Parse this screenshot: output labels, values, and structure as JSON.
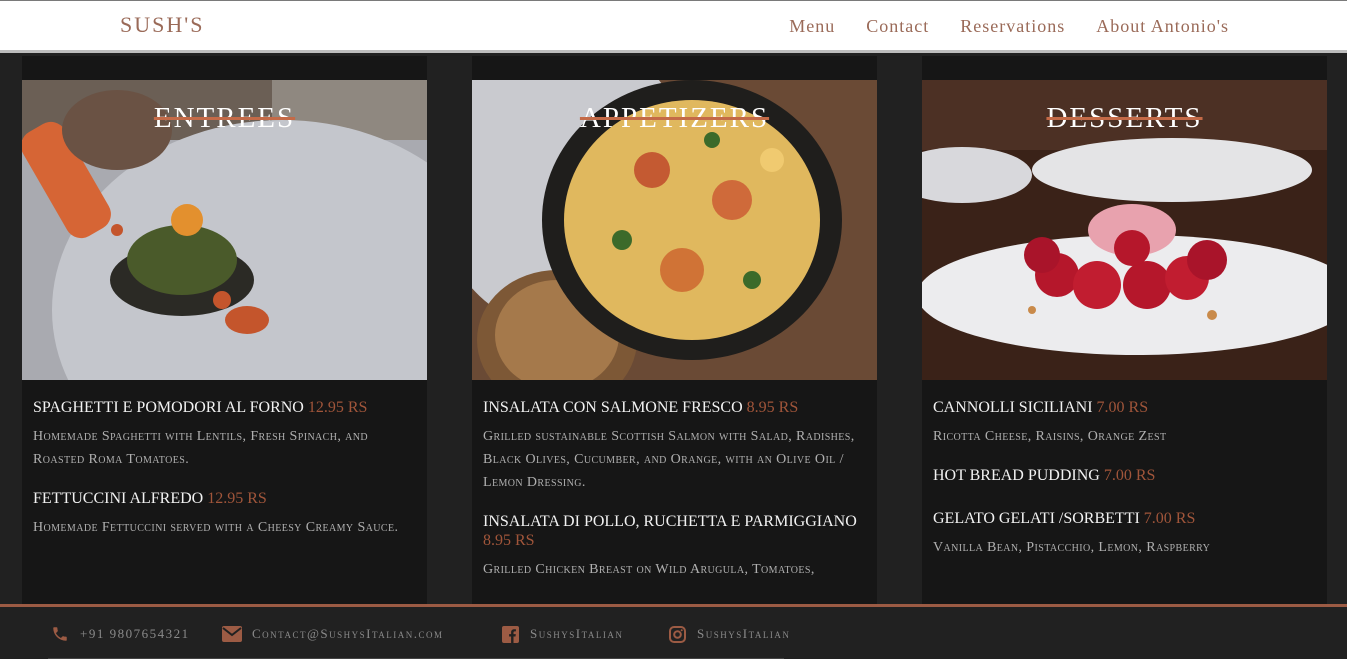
{
  "header": {
    "brand": "SUSH'S",
    "nav": [
      "Menu",
      "Contact",
      "Reservations",
      "About Antonio's"
    ]
  },
  "sections": [
    {
      "title": "ENTREES",
      "items": [
        {
          "name": "SPAGHETTI E POMODORI AL FORNO",
          "price": "12.95 RS",
          "desc": "Homemade Spaghetti with Lentils, Fresh Spinach, and Roasted Roma Tomatoes."
        },
        {
          "name": "FETTUCCINI ALFREDO",
          "price": "12.95 RS",
          "desc": "Homemade Fettuccini served with a Cheesy Creamy Sauce."
        }
      ]
    },
    {
      "title": "APPETIZERS",
      "items": [
        {
          "name": "INSALATA CON SALMONE FRESCO",
          "price": "8.95 RS",
          "desc": "Grilled sustainable Scottish Salmon with Salad, Radishes, Black Olives, Cucumber, and Orange, with an Olive Oil / Lemon Dressing."
        },
        {
          "name": "INSALATA DI POLLO, RUCHETTA E PARMIGGIANO",
          "price": "8.95 RS",
          "desc": "Grilled Chicken Breast on Wild Arugula, Tomatoes,"
        }
      ]
    },
    {
      "title": "DESSERTS",
      "items": [
        {
          "name": "CANNOLLI SICILIANI",
          "price": "7.00 RS",
          "desc": "Ricotta Cheese, Raisins, Orange Zest"
        },
        {
          "name": "HOT BREAD PUDDING",
          "price": "7.00 RS",
          "desc": ""
        },
        {
          "name": "GELATO GELATI /SORBETTI",
          "price": "7.00 RS",
          "desc": "Vanilla Bean, Pistacchio, Lemon, Raspberry"
        }
      ]
    }
  ],
  "footer": {
    "phone": "+91 9807654321",
    "email": "Contact@SushysItalian.com",
    "facebook": "SushysItalian",
    "instagram": "SushysItalian",
    "icons": [
      "phone-icon",
      "envelope-icon",
      "facebook-icon",
      "instagram-icon"
    ],
    "accent": "#9c5b44"
  }
}
